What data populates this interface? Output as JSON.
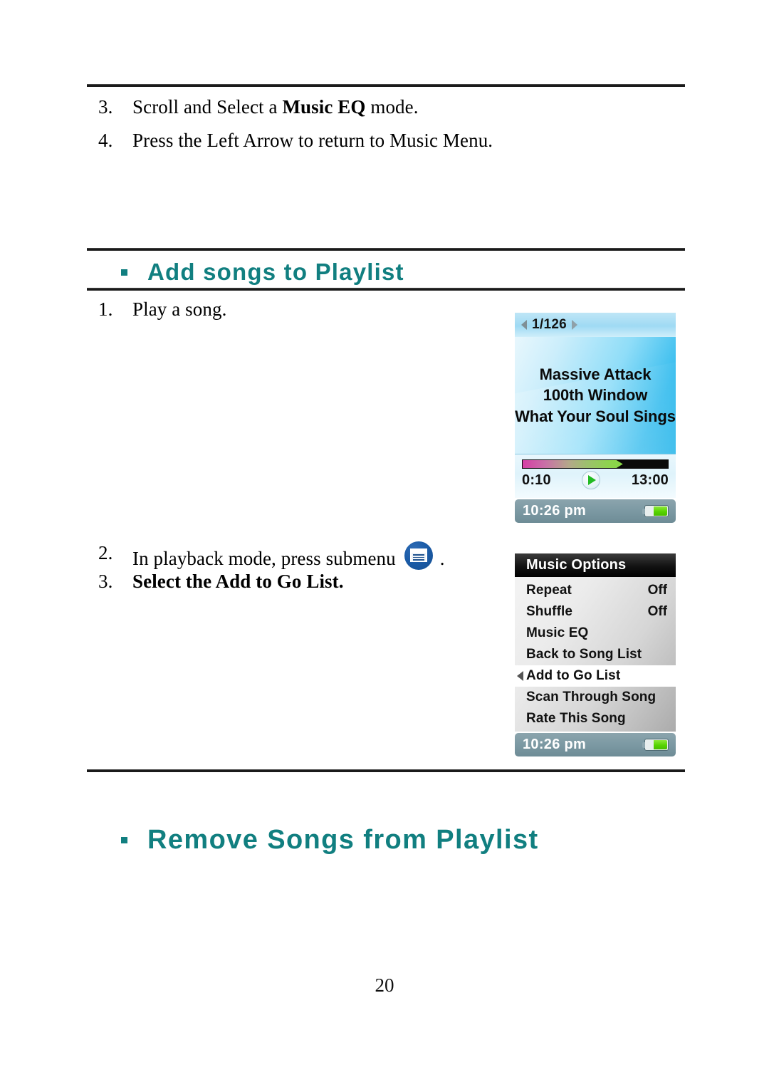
{
  "page": {
    "number": "20"
  },
  "steps_top": [
    {
      "num": "3.",
      "prefix": "Scroll and Select a ",
      "bold": "Music EQ",
      "suffix": " mode."
    },
    {
      "num": "4.",
      "prefix": "Press the Left Arrow to return to Music Menu.",
      "bold": "",
      "suffix": ""
    }
  ],
  "section_add": {
    "heading": "Add songs to Playlist",
    "bullet_icon": "square-bullet",
    "step1": {
      "num": "1.",
      "text": "Play a song."
    },
    "step2": {
      "num": "2.",
      "prefix": "In playback mode, press submenu",
      "suffix": ".",
      "icon": "submenu-icon"
    },
    "step3": {
      "num": "3.",
      "prefix": "Select the ",
      "bold": "Add to Go List.",
      "suffix": ""
    }
  },
  "section_remove": {
    "heading": "Remove Songs from Playlist",
    "bullet_icon": "square-bullet"
  },
  "player_screen": {
    "header": {
      "prev_icon": "triangle-left-icon",
      "track_position": "1/126",
      "next_icon": "triangle-right-icon"
    },
    "album_art": {
      "artist": "Massive Attack",
      "album": "100th Window",
      "track": "What Your Soul Sings"
    },
    "progress": {
      "elapsed": "0:10",
      "total": "13:00",
      "play_icon": "play-icon",
      "percent": 69
    },
    "status": {
      "clock": "10:26 pm",
      "battery_icon": "battery-icon"
    }
  },
  "menu_screen": {
    "title": "Music Options",
    "items": [
      {
        "label": "Repeat",
        "value": "Off",
        "selected": false
      },
      {
        "label": "Shuffle",
        "value": "Off",
        "selected": false
      },
      {
        "label": "Music EQ",
        "value": "",
        "selected": false
      },
      {
        "label": "Back to Song List",
        "value": "",
        "selected": false
      },
      {
        "label": "Add to Go List",
        "value": "",
        "selected": true
      },
      {
        "label": "Scan Through Song",
        "value": "",
        "selected": false
      },
      {
        "label": "Rate This Song",
        "value": "",
        "selected": false
      }
    ],
    "selected_arrow_icon": "triangle-left-icon",
    "status": {
      "clock": "10:26 pm",
      "battery_icon": "battery-icon"
    }
  },
  "colors": {
    "heading_teal": "#117f80",
    "rule_dark": "#1a1a1a",
    "submenu_blue": "#1b5ca8",
    "battery_green": "#57d400",
    "play_green": "#22bb22"
  }
}
